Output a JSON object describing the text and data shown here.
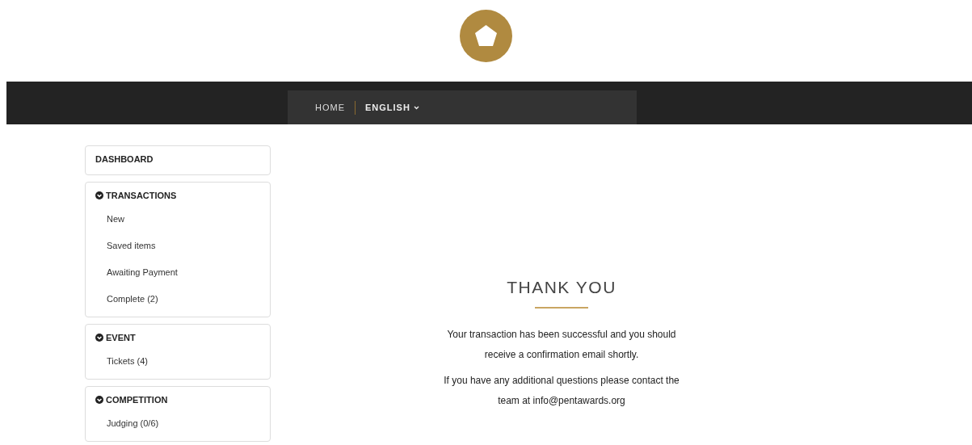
{
  "nav": {
    "items": [
      {
        "label": "HOME",
        "kind": "link"
      },
      {
        "label": "ENGLISH",
        "kind": "dropdown"
      }
    ]
  },
  "sidebar": {
    "sections": [
      {
        "title": "DASHBOARD",
        "kind": "link"
      },
      {
        "title": "TRANSACTIONS",
        "kind": "group",
        "expanded": true,
        "items": [
          "New",
          "Saved items",
          "Awaiting Payment",
          "Complete (2)"
        ]
      },
      {
        "title": "EVENT",
        "kind": "group",
        "expanded": true,
        "items": [
          "Tickets (4)"
        ]
      },
      {
        "title": "COMPETITION",
        "kind": "group",
        "expanded": true,
        "items": [
          "Judging (0/6)"
        ]
      }
    ]
  },
  "message": {
    "title": "THANK YOU",
    "paragraphs": [
      "Your transaction has been successful and you should receive a confirmation email shortly.",
      "If you have any additional questions please contact the team at info@pentawards.org"
    ]
  }
}
